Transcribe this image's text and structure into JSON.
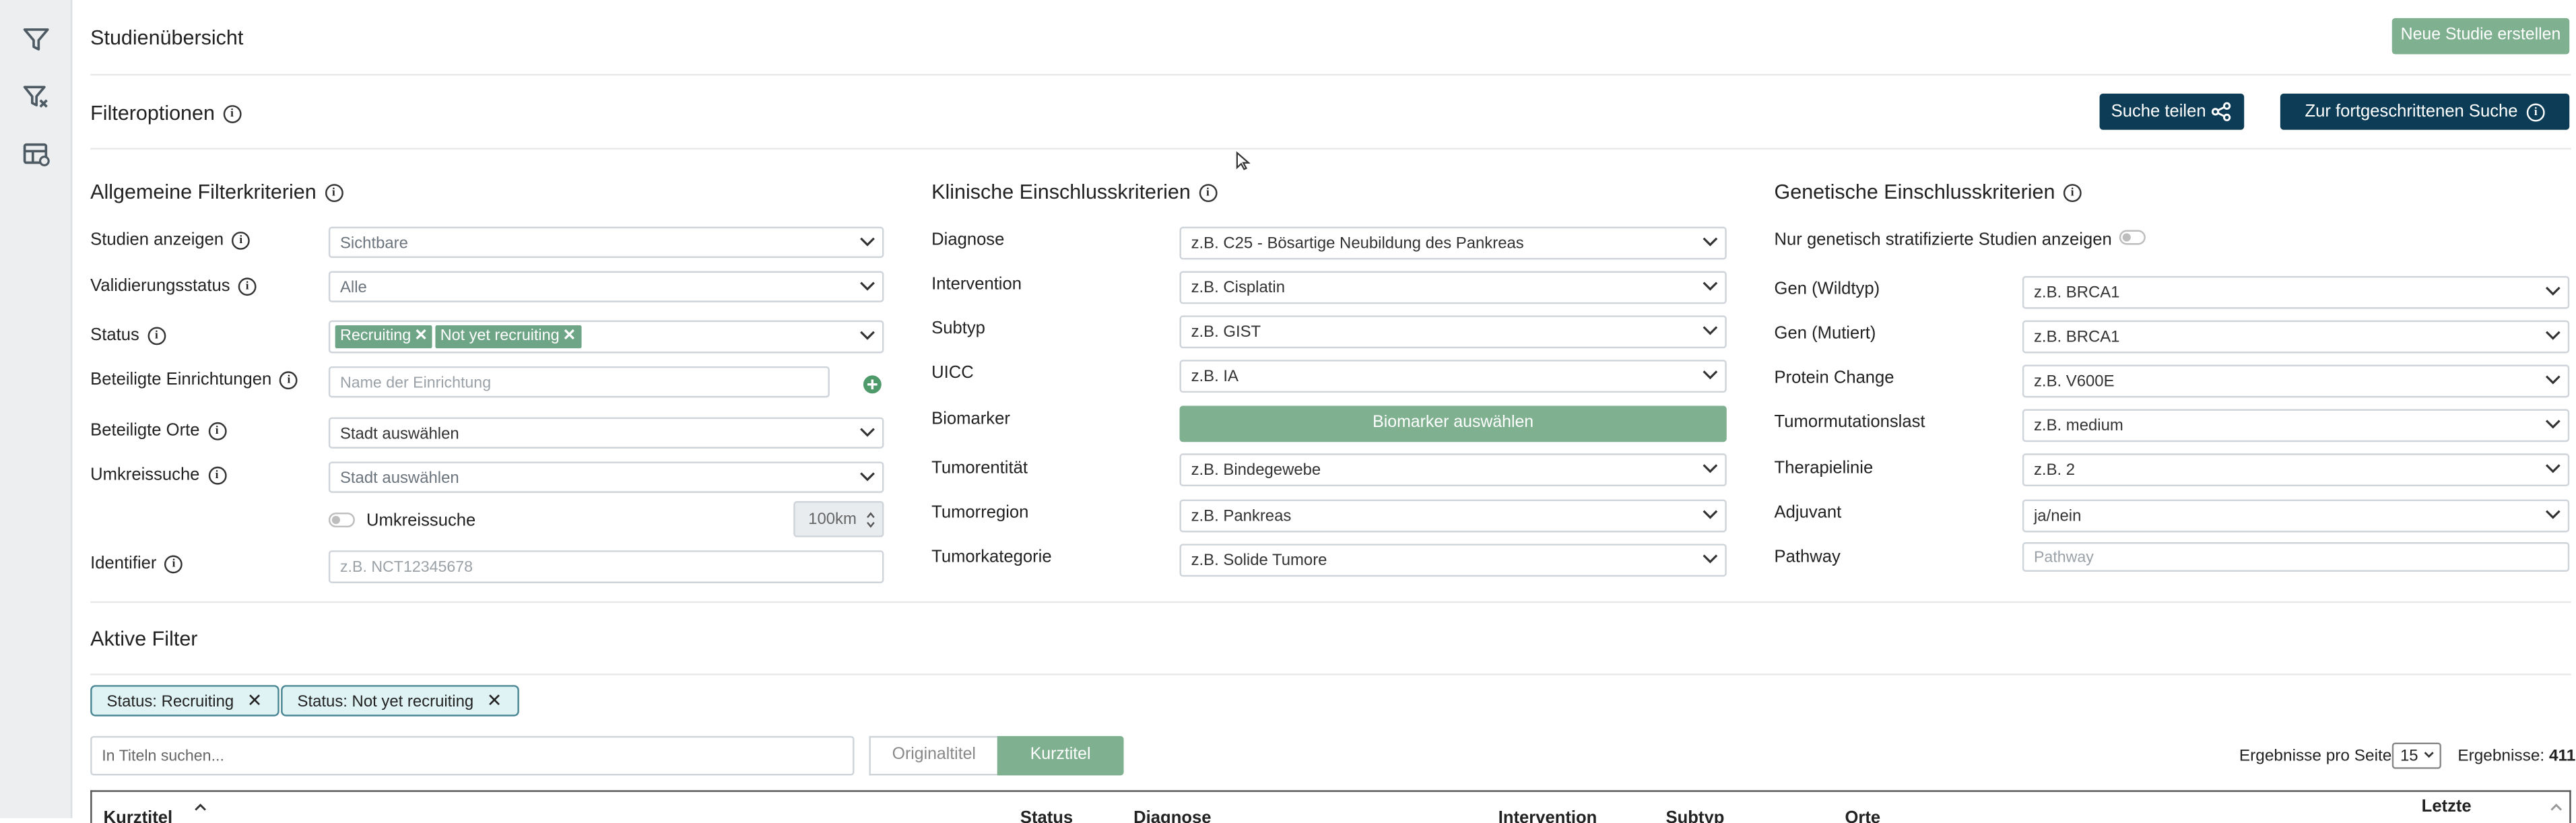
{
  "header": {
    "title": "Studienübersicht",
    "new_study_button": "Neue Studie erstellen"
  },
  "filter_options": {
    "title": "Filteroptionen",
    "share_button": "Suche teilen",
    "advanced_button": "Zur fortgeschrittenen Suche"
  },
  "general": {
    "title": "Allgemeine Filterkriterien",
    "labels": {
      "show_studies": "Studien anzeigen",
      "validation": "Validierungsstatus",
      "status": "Status",
      "institutions": "Beteiligte Einrichtungen",
      "locations": "Beteiligte Orte",
      "radius": "Umkreissuche",
      "identifier": "Identifier"
    },
    "values": {
      "show_studies": "Sichtbare",
      "validation": "Alle",
      "status_tags": [
        "Recruiting",
        "Not yet recruiting"
      ],
      "institutions_placeholder": "Name der Einrichtung",
      "locations": "Stadt auswählen",
      "radius": "Stadt auswählen",
      "radius_toggle_label": "Umkreissuche",
      "radius_km": "100km",
      "identifier_placeholder": "z.B. NCT12345678"
    }
  },
  "clinical": {
    "title": "Klinische Einschlusskriterien",
    "labels": [
      "Diagnose",
      "Intervention",
      "Subtyp",
      "UICC",
      "Biomarker",
      "Tumorentität",
      "Tumorregion",
      "Tumorkategorie"
    ],
    "values": {
      "diagnose": "z.B. C25 - Bösartige Neubildung des Pankreas",
      "intervention": "z.B. Cisplatin",
      "subtyp": "z.B. GIST",
      "uicc": "z.B. IA",
      "biomarker_button": "Biomarker auswählen",
      "tumorentitaet": "z.B. Bindegewebe",
      "tumorregion": "z.B. Pankreas",
      "tumorkategorie": "z.B. Solide Tumore"
    }
  },
  "genetic": {
    "title": "Genetische Einschlusskriterien",
    "only_stratified": "Nur genetisch stratifizierte Studien anzeigen",
    "labels": [
      "Gen (Wildtyp)",
      "Gen (Mutiert)",
      "Protein Change",
      "Tumormutationslast",
      "Therapielinie",
      "Adjuvant",
      "Pathway"
    ],
    "values": {
      "gen_wild": "z.B. BRCA1",
      "gen_mut": "z.B. BRCA1",
      "protein": "z.B. V600E",
      "tml": "z.B. medium",
      "therapie": "z.B. 2",
      "adjuvant": "ja/nein",
      "pathway_placeholder": "Pathway"
    }
  },
  "active_filters": {
    "title": "Aktive Filter",
    "chips": [
      "Status: Recruiting",
      "Status: Not yet recruiting"
    ]
  },
  "results": {
    "search_placeholder": "In Titeln suchen...",
    "toggle_original": "Originaltitel",
    "toggle_short": "Kurztitel",
    "per_page_label": "Ergebnisse pro Seite",
    "per_page_value": "15",
    "count_label": "Ergebnisse:",
    "count_value": "411",
    "columns": [
      "Kurztitel",
      "Status",
      "Diagnose",
      "Intervention",
      "Subtyp",
      "Orte",
      "Letzte"
    ]
  },
  "colors": {
    "dark_button": "#0d3d56",
    "green": "#7fb08f",
    "tag_green": "#6fa587",
    "chip_bg": "#dff3f5"
  }
}
